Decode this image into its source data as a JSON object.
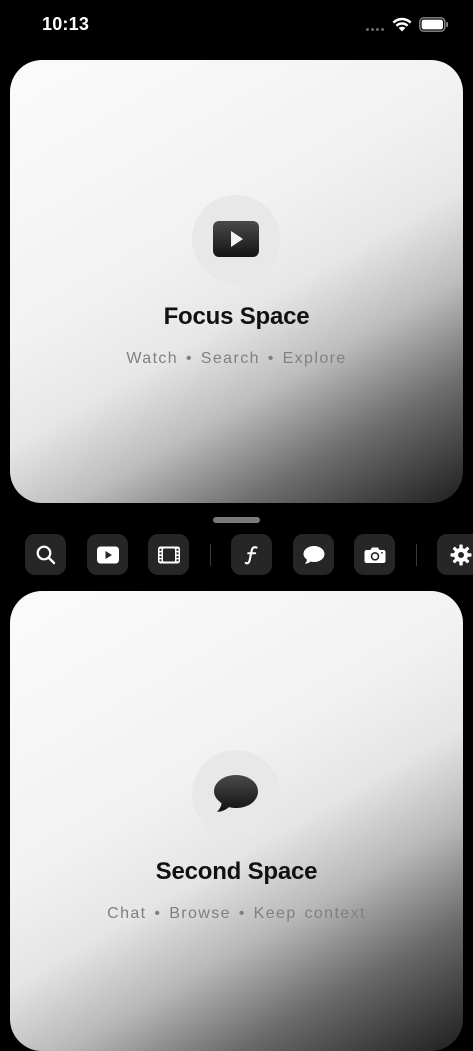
{
  "status_bar": {
    "time": "10:13"
  },
  "cards": {
    "top": {
      "title": "Focus Space",
      "subtitle": "Watch • Search • Explore",
      "icon": "play-rectangle-icon"
    },
    "bottom": {
      "title": "Second Space",
      "subtitle": "Chat • Browse • Keep context",
      "icon": "chat-bubble-icon"
    }
  },
  "toolbar": {
    "items": [
      {
        "icon": "search-icon"
      },
      {
        "icon": "play-rectangle-icon"
      },
      {
        "icon": "film-strip-icon"
      },
      {
        "icon": "function-icon"
      },
      {
        "icon": "chat-bubble-icon"
      },
      {
        "icon": "camera-icon"
      },
      {
        "icon": "gear-icon"
      }
    ]
  },
  "colors": {
    "background": "#000000",
    "toolbar_button": "#262626",
    "card_title": "#111111",
    "card_subtitle": "#808080"
  }
}
